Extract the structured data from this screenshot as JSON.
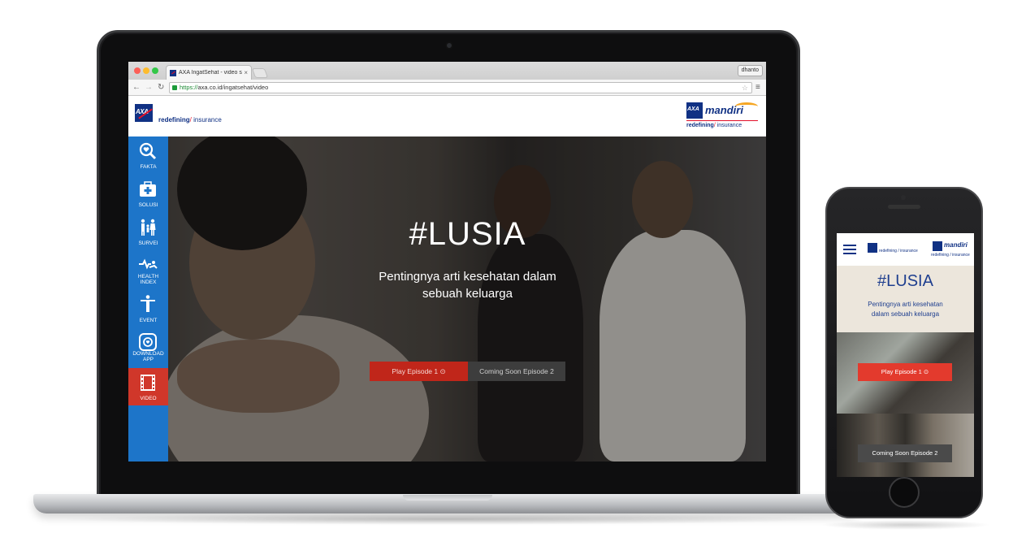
{
  "browser": {
    "tab_title": "AXA IngatSehat - video se",
    "tab_close": "×",
    "profile_name": "dhanto",
    "url_scheme": "https://",
    "url_rest": "axa.co.id/ingatsehat/video",
    "nav_back": "←",
    "nav_forward": "→",
    "nav_reload": "↻",
    "bookmark_star": "☆",
    "menu": "≡"
  },
  "header": {
    "logo_text": "AXA",
    "tagline_bold": "redefining",
    "tagline_slash": "/",
    "tagline_rest": " insurance",
    "partner_logo_text": "AXA",
    "partner_name": "mandiri",
    "partner_tagline_bold": "redefining",
    "partner_tagline_slash": "/",
    "partner_tagline_rest": " insurance"
  },
  "sidebar": {
    "items": [
      {
        "label": "FAKTA",
        "icon": "magnifier-heart-icon"
      },
      {
        "label": "SOLUSI",
        "icon": "medical-kit-icon"
      },
      {
        "label": "SURVEI",
        "icon": "family-icon"
      },
      {
        "label_line1": "HEALTH",
        "label_line2": "INDEX",
        "icon": "health-index-icon"
      },
      {
        "label": "EVENT",
        "icon": "event-figure-icon"
      },
      {
        "label_line1": "DOWNLOAD",
        "label_line2": "APP",
        "icon": "app-download-icon"
      },
      {
        "label": "VIDEO",
        "icon": "film-icon",
        "active": true
      }
    ],
    "colors": {
      "background": "#1d75c9",
      "active": "#d0372a"
    }
  },
  "hero": {
    "title": "#LUSIA",
    "subtitle_line1": "Pentingnya arti kesehatan dalam",
    "subtitle_line2": "sebuah keluarga",
    "play_button": "Play Episode 1 ⊙",
    "coming_soon_button": "Coming Soon Episode 2"
  },
  "mobile": {
    "tagline": "redefining / insurance",
    "partner_name": "mandiri",
    "partner_tagline": "redefining / insurance",
    "title": "#LUSIA",
    "subtitle_line1": "Pentingnya arti kesehatan",
    "subtitle_line2": "dalam sebuah keluarga",
    "play_button": "Play Episode 1 ⊙",
    "coming_soon_button": "Coming Soon Episode 2"
  }
}
